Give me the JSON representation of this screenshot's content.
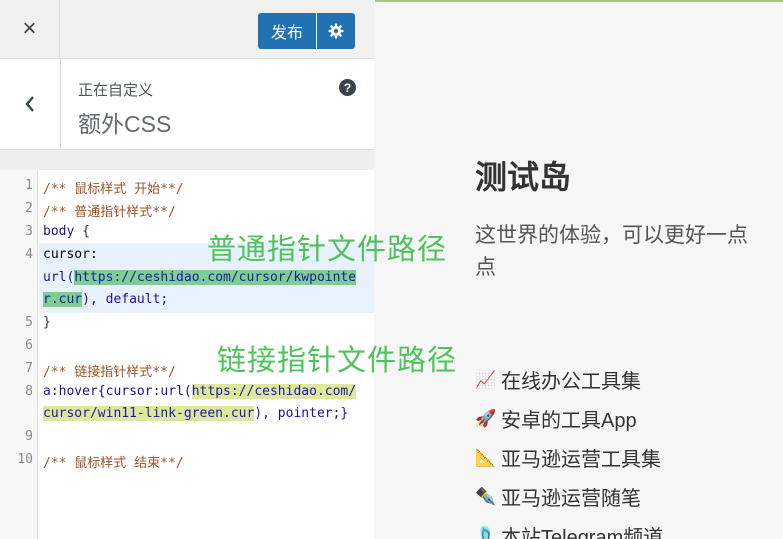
{
  "topbar": {
    "close_icon": "×",
    "publish_label": "发布",
    "settings_icon": "gear-icon"
  },
  "section": {
    "breadcrumb": "正在自定义",
    "title": "额外CSS",
    "help_icon": "?"
  },
  "editor": {
    "line_numbers": [
      "1",
      "2",
      "3",
      "4",
      "5",
      "6",
      "7",
      "8",
      "9",
      "10"
    ],
    "lines": {
      "l1": "/** 鼠标样式 开始**/",
      "l2": "/** 普通指针样式**/",
      "l3_sel": "body",
      "l3_brace": " {",
      "l4a": "cursor:",
      "l4b_pre": "url(",
      "l4b_url": "https://ceshidao.com/cursor/kwpointe",
      "l4c_url": "r.cur",
      "l4c_post": "), default;",
      "l5": "}",
      "l7": "/** 链接指针样式**/",
      "l8a_sel": "a:hover",
      "l8a_pre": "{cursor:url(",
      "l8a_url": "https://ceshidao.com/",
      "l8b_url": "cursor/win11-link-green.cur",
      "l8b_post": "), pointer;}",
      "l10": "/** 鼠标样式 结束**/"
    }
  },
  "annotations": {
    "normal": "普通指针文件路径",
    "link": "链接指针文件路径"
  },
  "preview": {
    "site_title": "测试岛",
    "tagline": "这世界的体验，可以更好一点点",
    "links": [
      {
        "icon": "📈",
        "label": "在线办公工具集"
      },
      {
        "icon": "🚀",
        "label": "安卓的工具App"
      },
      {
        "icon": "📐",
        "label": "亚马逊运营工具集"
      },
      {
        "icon": "✒️",
        "label": "亚马逊运营随笔"
      },
      {
        "icon": "🩴",
        "label": "本站Telegram频道"
      }
    ]
  }
}
